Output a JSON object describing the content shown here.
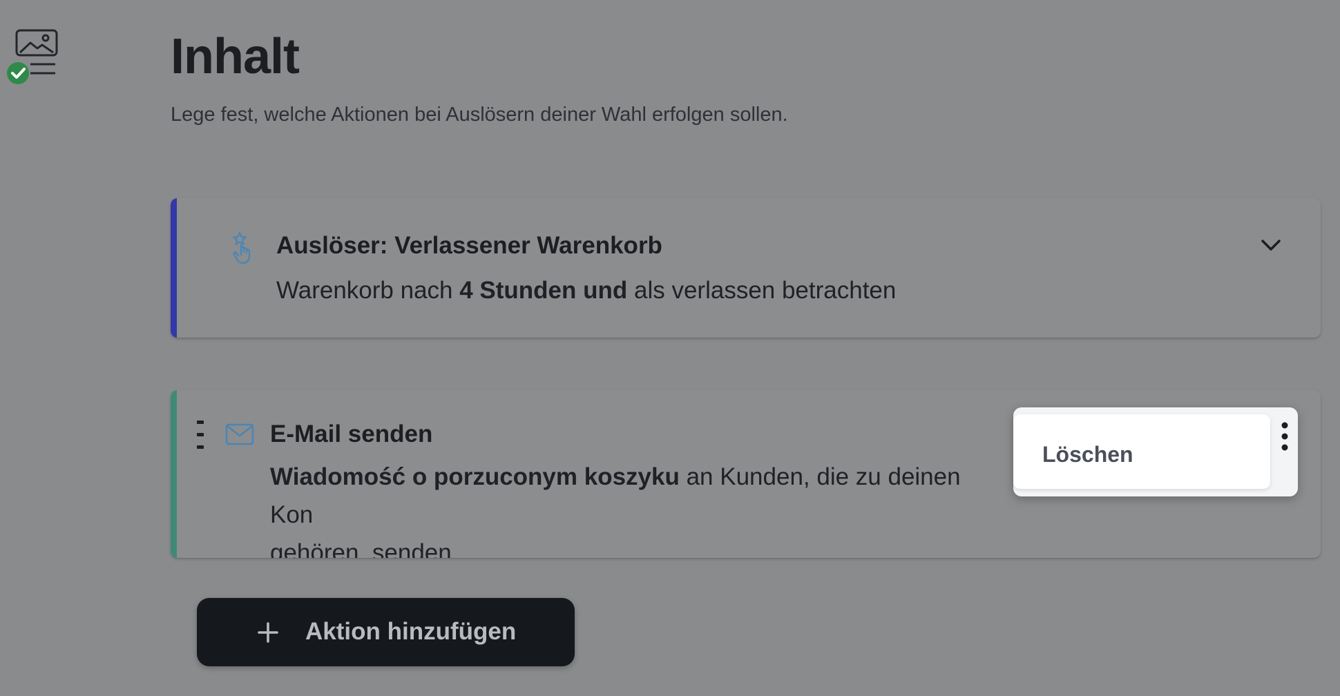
{
  "header": {
    "title": "Inhalt",
    "subtitle": "Lege fest, welche Aktionen bei Auslösern deiner Wahl erfolgen sollen."
  },
  "trigger_card": {
    "title": "Auslöser: Verlassener Warenkorb",
    "description_prefix": "Warenkorb nach ",
    "description_bold": "4 Stunden und",
    "description_suffix": " als verlassen betrachten",
    "icon": "tap-star-icon",
    "accent_color": "#3437a6"
  },
  "action_card": {
    "title": "E-Mail senden",
    "description_bold": "Wiadomość o porzuconym koszyku",
    "description_rest_line1": " an Kunden, die zu deinen Kon",
    "description_line2": "gehören, senden",
    "icon": "mail-icon",
    "accent_color": "#3f8a76"
  },
  "menu": {
    "items": [
      {
        "label": "Löschen"
      }
    ]
  },
  "add_action_button": {
    "label": "Aktion hinzufügen",
    "icon": "plus-icon"
  },
  "rail": {
    "icon": "image-content-check-icon"
  }
}
